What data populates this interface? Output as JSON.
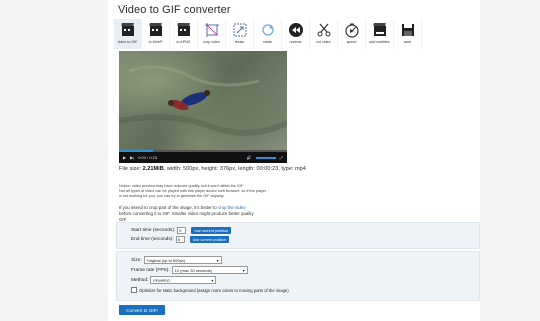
{
  "title": "Video to GIF converter",
  "toolbar": [
    {
      "label": "video to GIF",
      "icon": "film-icon"
    },
    {
      "label": "to WebP",
      "icon": "film-icon"
    },
    {
      "label": "to APNG",
      "icon": "film-icon"
    },
    {
      "label": "crop video",
      "icon": "crop-icon"
    },
    {
      "label": "resize",
      "icon": "resize-icon"
    },
    {
      "label": "rotate",
      "icon": "rotate-icon"
    },
    {
      "label": "reverse",
      "icon": "rewind-icon"
    },
    {
      "label": "cut video",
      "icon": "scissors-icon"
    },
    {
      "label": "speed",
      "icon": "speed-icon"
    },
    {
      "label": "add subtitles",
      "icon": "subtitles-icon"
    },
    {
      "label": "save",
      "icon": "save-icon"
    }
  ],
  "player": {
    "time": "0:00 / 0:23",
    "progress": 0.2
  },
  "fileinfo": {
    "label": "File size:",
    "size": "2.21MiB",
    "rest": ", width: 500px, height: 376px, length: 00:00:23, type: mp4"
  },
  "notice": [
    "Notice: video preview may have reduced quality, but it won't affect the GIF.",
    "Not all types of video can be played with this player and/or web browser, so if the player",
    "is not working for you, you can try to generate the GIF anyway."
  ],
  "crop_note": {
    "pre": "If you intend to crop part of the image, it's better to",
    "link": "crop the video",
    "post": "before converting it to GIF. Smaller video might produce better quality GIF."
  },
  "time": {
    "start_label": "Start time (seconds):",
    "start_value": "0",
    "end_label": "End time (seconds):",
    "end_value": "8",
    "use_current": "Use current position"
  },
  "options": {
    "size_label": "Size:",
    "size_value": "Original (up to 600px)",
    "fps_label": "Frame rate (FPS):",
    "fps_value": "10 (max 30 seconds)",
    "method_label": "Method:",
    "method_value": "FFMPEG",
    "optimize_label": "Optimize for static background (assign more colors to moving parts of the image)"
  },
  "convert_label": "Convert to GIF!"
}
